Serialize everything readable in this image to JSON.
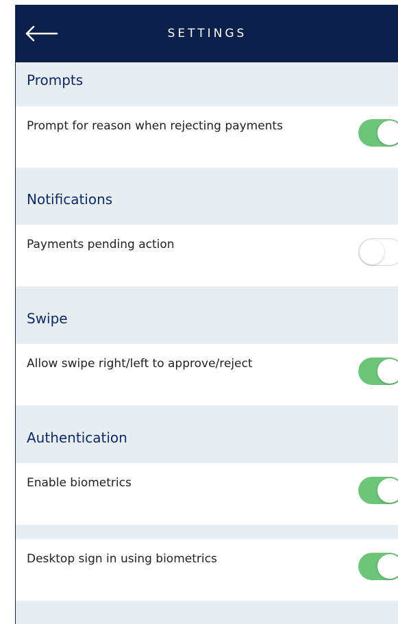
{
  "header": {
    "title": "SETTINGS",
    "back_icon": "arrow-left-icon"
  },
  "sections": {
    "prompts": {
      "title": "Prompts",
      "items": [
        {
          "label": "Prompt for reason when rejecting payments",
          "enabled": true
        }
      ]
    },
    "notifications": {
      "title": "Notifications",
      "items": [
        {
          "label": "Payments pending action",
          "enabled": false
        }
      ]
    },
    "swipe": {
      "title": "Swipe",
      "items": [
        {
          "label": "Allow swipe right/left to approve/reject",
          "enabled": true
        }
      ]
    },
    "authentication": {
      "title": "Authentication",
      "items": [
        {
          "label": "Enable biometrics",
          "enabled": true
        },
        {
          "label": "Desktop sign in using biometrics",
          "enabled": true
        }
      ]
    }
  },
  "colors": {
    "header_bg": "#0b1f4b",
    "section_bg": "#e8edf2",
    "section_title": "#0b2a63",
    "toggle_on": "#6cc57b",
    "toggle_off_border": "#d6d8dc"
  }
}
